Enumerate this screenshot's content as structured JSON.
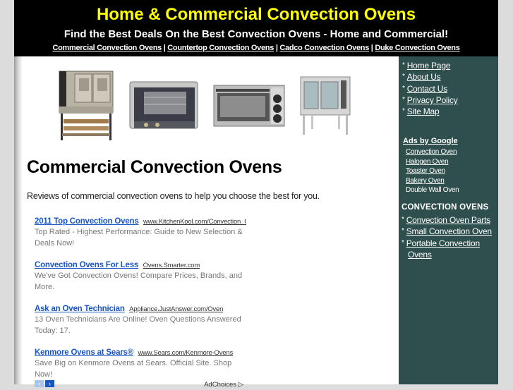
{
  "header": {
    "title": "Home & Commercial Convection Ovens",
    "tagline": "Find the Best Deals On the Best Convection Ovens - Home and Commercial!",
    "nav": [
      {
        "label": "Commercial Convection Ovens"
      },
      {
        "label": "Countertop Convection Ovens"
      },
      {
        "label": "Cadco Convection Ovens"
      },
      {
        "label": "Duke Convection Ovens"
      }
    ],
    "nav_separator": " | "
  },
  "main": {
    "images": [
      {
        "alt": "commercial convection oven on stand"
      },
      {
        "alt": "countertop convection oven"
      },
      {
        "alt": "toaster convection oven with knobs"
      },
      {
        "alt": "full-size convection oven"
      }
    ],
    "heading": "Commercial Convection Ovens",
    "intro": "Reviews of commercial convection ovens to help you choose the best for you.",
    "ads": [
      {
        "title": "2011 Top Convection Ovens",
        "url": "www.KitchenKool.com/Convection_Ovens",
        "desc": "Top Rated - Highest Performance: Guide to New Selection & Deals Now!"
      },
      {
        "title": "Convection Ovens For Less",
        "url": "Ovens.Smarter.com",
        "desc": "We've Got Convection Ovens! Compare Prices, Brands, and More."
      },
      {
        "title": "Ask an Oven Technician",
        "url": "Appliance.JustAnswer.com/Oven",
        "desc": "13 Oven Technicians Are Online! Oven Questions Answered Today: 17."
      },
      {
        "title": "Kenmore Ovens at Sears®",
        "url": "www.Sears.com/Kenmore-Ovens",
        "desc": "Save Big on Kenmore Ovens at Sears. Official Site. Shop Now!"
      }
    ],
    "ad_footer": {
      "prev": "‹",
      "next": "›",
      "adchoices": "AdChoices"
    },
    "colors": {
      "ad_title": "#1a55c4",
      "ad_desc": "#777777"
    }
  },
  "sidebar": {
    "bullet": "*",
    "nav": [
      {
        "label": "Home Page"
      },
      {
        "label": "About Us"
      },
      {
        "label": "Contact Us"
      },
      {
        "label": "Privacy Policy"
      },
      {
        "label": "Site Map"
      }
    ],
    "ads_label": "Ads by Google",
    "google_ads": [
      {
        "label": "Convection Oven",
        "link": true
      },
      {
        "label": "Halogen Oven",
        "link": true
      },
      {
        "label": "Toaster Oven",
        "link": true
      },
      {
        "label": "Bakery Oven",
        "link": true
      },
      {
        "label": "Double Wall Oven",
        "link": false
      }
    ],
    "section_heading": "CONVECTION OVENS",
    "section_links": [
      {
        "label": "Convection Oven Parts"
      },
      {
        "label": "Small Convection Oven"
      },
      {
        "label": "Portable Convection",
        "label2": "Ovens"
      }
    ],
    "colors": {
      "background": "#2e4f4d"
    }
  },
  "colors": {
    "header_bg": "#000000",
    "title": "#ffff00",
    "page_bg": "#dcdcdc"
  }
}
